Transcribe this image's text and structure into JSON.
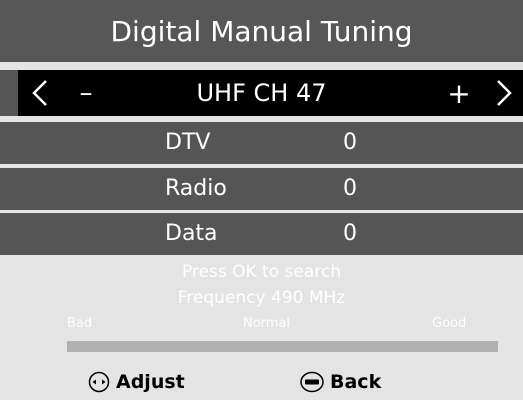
{
  "header": {
    "title": "Digital Manual Tuning"
  },
  "channel": {
    "label": "UHF CH 47",
    "minus": "–",
    "plus": "+",
    "prev_icon": "chevron-left-icon",
    "next_icon": "chevron-right-icon"
  },
  "rows": [
    {
      "label": "DTV",
      "value": "0"
    },
    {
      "label": "Radio",
      "value": "0"
    },
    {
      "label": "Data",
      "value": "0"
    }
  ],
  "info": {
    "prompt": "Press OK to search",
    "frequency": "Frequency 490 MHz"
  },
  "signal": {
    "bad_label": "Bad",
    "normal_label": "Normal",
    "good_label": "Good",
    "level": 0
  },
  "footer": {
    "adjust_label": "Adjust",
    "adjust_icon": "left-right-dpad-icon",
    "back_label": "Back",
    "back_icon": "menu-button-icon"
  },
  "colors": {
    "title_bg": "#575757",
    "channel_bg": "#000000",
    "row_bg": "#555555",
    "page_bg": "#e4e4e4"
  }
}
